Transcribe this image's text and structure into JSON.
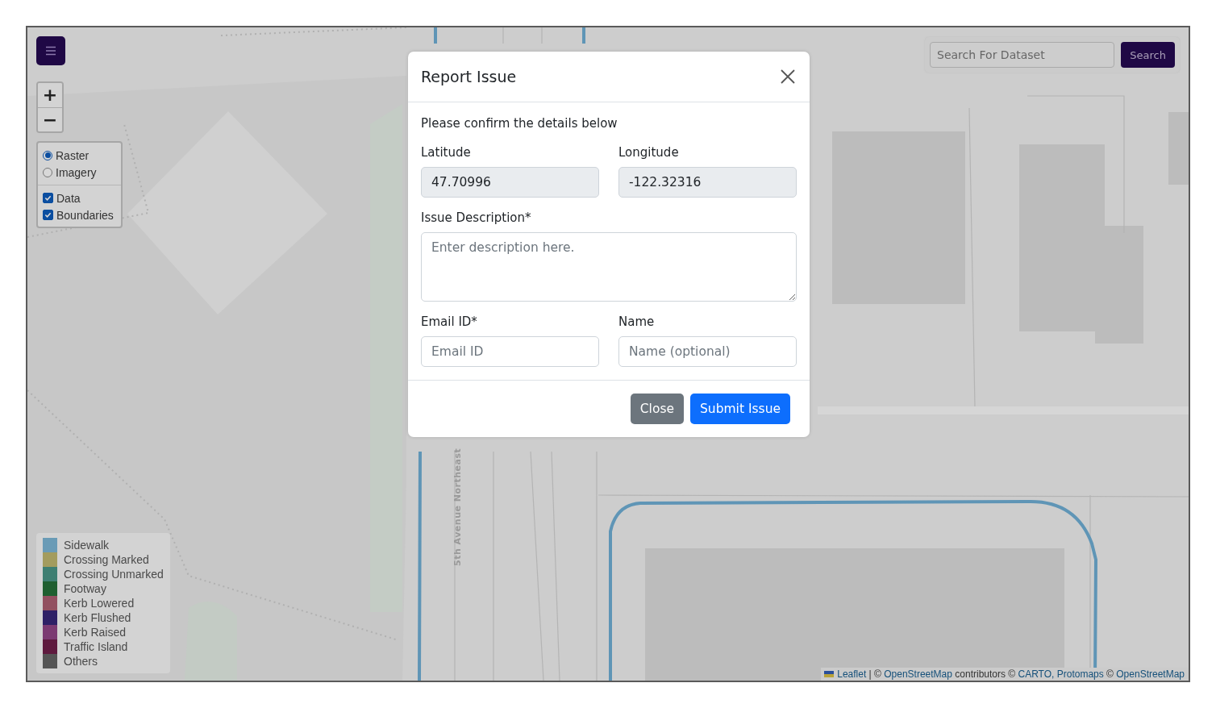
{
  "zoom": {
    "zoom_in": "+",
    "zoom_out": "−"
  },
  "layers": {
    "base": [
      {
        "label": "Raster",
        "selected": true
      },
      {
        "label": "Imagery",
        "selected": false
      }
    ],
    "overlays": [
      {
        "label": "Data",
        "checked": true
      },
      {
        "label": "Boundaries",
        "checked": true
      }
    ]
  },
  "search": {
    "placeholder": "Search For Dataset",
    "button": "Search"
  },
  "map": {
    "street_label": "5th Avenue Northeast"
  },
  "legend": [
    {
      "label": "Sidewalk",
      "color": "#6a9bb6"
    },
    {
      "label": "Crossing Marked",
      "color": "#a39c5e"
    },
    {
      "label": "Crossing Unmarked",
      "color": "#3e7f72"
    },
    {
      "label": "Footway",
      "color": "#1f5f30"
    },
    {
      "label": "Kerb Lowered",
      "color": "#925060"
    },
    {
      "label": "Kerb Flushed",
      "color": "#2e2066"
    },
    {
      "label": "Kerb Raised",
      "color": "#7b3a72"
    },
    {
      "label": "Traffic Island",
      "color": "#5e1a3e"
    },
    {
      "label": "Others",
      "color": "#555555"
    }
  ],
  "attribution": [
    {
      "kind": "link",
      "text": "Leaflet"
    },
    {
      "kind": "text",
      "text": " | © "
    },
    {
      "kind": "link",
      "text": "OpenStreetMap"
    },
    {
      "kind": "text",
      "text": " contributors © "
    },
    {
      "kind": "link",
      "text": "CARTO, Protomaps"
    },
    {
      "kind": "text",
      "text": " © "
    },
    {
      "kind": "link",
      "text": "OpenStreetMap"
    }
  ],
  "modal": {
    "title": "Report Issue",
    "intro": "Please confirm the details below",
    "rows": [
      [
        {
          "kind": "readonly",
          "label": "Latitude",
          "value": "47.70996"
        },
        {
          "kind": "readonly",
          "label": "Longitude",
          "value": "-122.32316"
        }
      ],
      [
        {
          "kind": "textarea",
          "label": "Issue Description*",
          "placeholder": "Enter description here."
        }
      ],
      [
        {
          "kind": "input",
          "label": "Email ID*",
          "placeholder": "Email ID"
        },
        {
          "kind": "input",
          "label": "Name",
          "placeholder": "Name (optional)"
        }
      ]
    ],
    "buttons": [
      {
        "kind": "secondary",
        "label": "Close"
      },
      {
        "kind": "primary",
        "label": "Submit Issue"
      }
    ]
  }
}
